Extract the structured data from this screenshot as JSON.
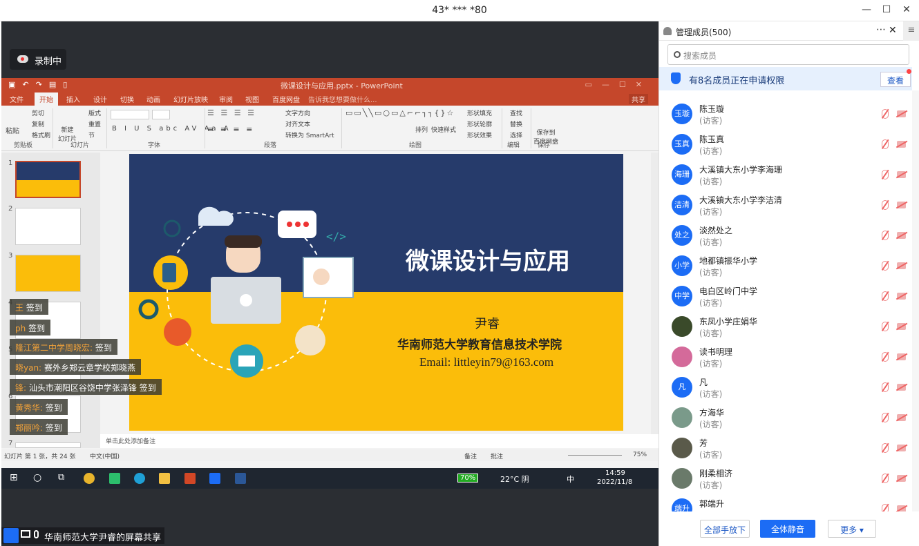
{
  "window": {
    "title": "43* *** *80"
  },
  "recording": {
    "label": "录制中"
  },
  "ppt": {
    "doc_title": "微课设计与应用.pptx - PowerPoint",
    "tabs": [
      "文件",
      "开始",
      "插入",
      "设计",
      "切换",
      "动画",
      "幻灯片放映",
      "审阅",
      "视图",
      "百度网盘"
    ],
    "tell_me": "告诉我您想要做什么...",
    "share": "共享",
    "groups": [
      "剪贴板",
      "幻灯片",
      "字体",
      "段落",
      "绘图",
      "编辑",
      "保存"
    ],
    "ribbon_items": {
      "paste": "粘贴",
      "cut": "剪切",
      "copy": "复制",
      "format_painter": "格式刷",
      "new_slide": "新建\n幻灯片",
      "layout": "版式",
      "reset": "重置",
      "section": "节",
      "text_dir": "文字方向",
      "align_text": "对齐文本",
      "smartart": "转换为 SmartArt",
      "arrange": "排列",
      "quick_styles": "快速样式",
      "fill": "形状填充",
      "outline": "形状轮廓",
      "effects": "形状效果",
      "find": "查找",
      "replace": "替换",
      "select": "选择",
      "save_baidu": "保存到\n百度网盘"
    },
    "slide": {
      "title": "微课设计与应用",
      "author": "尹睿",
      "school": "华南师范大学教育信息技术学院",
      "email": "Email: littleyin79@163.com"
    },
    "thumb_numbers": [
      "1",
      "2",
      "3",
      "4",
      "5",
      "6",
      "7"
    ],
    "notes": "单击此处添加备注",
    "status": {
      "slide_info": "幻灯片 第 1 张，共 24 张",
      "lang": "中文(中国)",
      "notes_btn": "备注",
      "comments_btn": "批注",
      "zoom": "75%"
    }
  },
  "taskbar": {
    "battery": "70%",
    "weather": "22°C 阴",
    "ime": "中",
    "time": "14:59",
    "date": "2022/11/8"
  },
  "signins": [
    {
      "who": "王",
      "text": "签到"
    },
    {
      "who": "ph",
      "text": "签到"
    },
    {
      "who": "隆江第二中学周晓宏:",
      "text": "签到"
    },
    {
      "who": "晓yan:",
      "text": "赛外乡郑云章学校郑晓燕"
    },
    {
      "who": "锋:",
      "text": "汕头市潮阳区谷饶中学张泽锋 签到"
    },
    {
      "who": "黄秀华:",
      "text": "签到"
    },
    {
      "who": "郑丽吟:",
      "text": "签到"
    }
  ],
  "sharer": {
    "label": "华南师范大学尹睿的屏幕共享"
  },
  "panel": {
    "title": "管理成员(500)",
    "search_placeholder": "搜索成员",
    "notice": "有8名成员正在申请权限",
    "view": "查看",
    "members": [
      {
        "avatar": "玉璇",
        "name": "陈玉璇",
        "role": "(访客)"
      },
      {
        "avatar": "玉真",
        "name": "陈玉真",
        "role": "(访客)"
      },
      {
        "avatar": "海珊",
        "name": "大溪镇大东小学李海珊",
        "role": "(访客)"
      },
      {
        "avatar": "洁清",
        "name": "大溪镇大东小学李洁清",
        "role": "(访客)"
      },
      {
        "avatar": "处之",
        "name": "淡然处之",
        "role": "(访客)"
      },
      {
        "avatar": "小学",
        "name": "地都镇振华小学",
        "role": "(访客)"
      },
      {
        "avatar": "中学",
        "name": "电白区岭门中学",
        "role": "(访客)"
      },
      {
        "avatar": "",
        "name": "东凤小学庄娟华",
        "role": "(访客)"
      },
      {
        "avatar": "",
        "name": "读书明理",
        "role": "(访客)"
      },
      {
        "avatar": "凡",
        "name": "凡",
        "role": "(访客)"
      },
      {
        "avatar": "",
        "name": "方海华",
        "role": "(访客)"
      },
      {
        "avatar": "",
        "name": "芳",
        "role": "(访客)"
      },
      {
        "avatar": "",
        "name": "刚柔相济",
        "role": "(访客)"
      },
      {
        "avatar": "端升",
        "name": "郭端升",
        "role": ""
      }
    ],
    "buttons": {
      "lower_all": "全部手放下",
      "mute_all": "全体静音",
      "more": "更多 ▾"
    }
  },
  "colors": {
    "accent": "#1c6cf5",
    "ppt": "#c5472b",
    "slide_top": "#263b6b",
    "slide_bottom": "#fbbd0a"
  }
}
